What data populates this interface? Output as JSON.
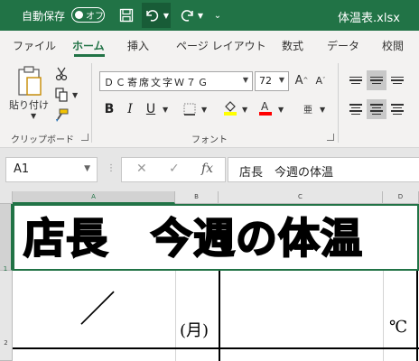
{
  "titlebar": {
    "autosave_label": "自動保存",
    "autosave_state": "オフ",
    "filename": "体温表.xlsx",
    "icons": [
      "save-icon",
      "undo-icon",
      "redo-icon",
      "customize-qat-icon"
    ]
  },
  "tabs": [
    {
      "label": "ファイル",
      "active": false
    },
    {
      "label": "ホーム",
      "active": true
    },
    {
      "label": "挿入",
      "active": false
    },
    {
      "label": "ページ レイアウト",
      "active": false
    },
    {
      "label": "数式",
      "active": false
    },
    {
      "label": "データ",
      "active": false
    },
    {
      "label": "校閲",
      "active": false
    }
  ],
  "ribbon": {
    "clipboard": {
      "paste_label": "貼り付け",
      "group_label": "クリップボード"
    },
    "font": {
      "font_name": "ＤＣ寄席文字Ｗ７Ｇ",
      "font_size": "72",
      "group_label": "フォント",
      "bold": "B",
      "italic": "I",
      "underline": "U",
      "highlight_color": "#ffff00",
      "font_color": "#ff0000"
    }
  },
  "formula_bar": {
    "name_box": "A1",
    "fx_label": "fx",
    "formula": "店長　今週の体温"
  },
  "sheet": {
    "columns": [
      "A",
      "B",
      "C",
      "D"
    ],
    "selected_column": "A",
    "rows": [
      "1",
      "2"
    ],
    "selected_row": "1",
    "a1_text": "店長　今週の体温",
    "a2_text": "／",
    "b2_text": "(月)",
    "d2_text": "℃"
  },
  "colors": {
    "accent": "#217346",
    "ribbon_bg": "#f3f2f1"
  }
}
